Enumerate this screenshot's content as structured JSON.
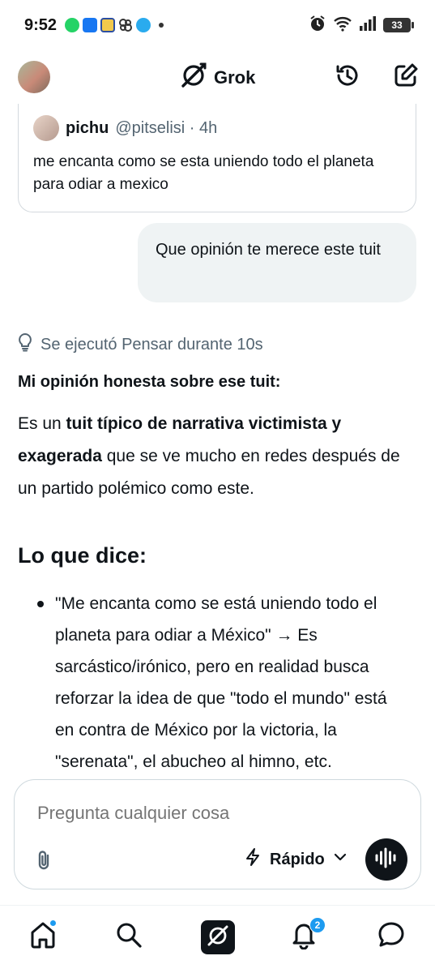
{
  "status_bar": {
    "time": "9:52",
    "battery": "33",
    "app_icons": [
      "whatsapp-icon",
      "facebook-icon",
      "news-icon",
      "pinwheel-icon",
      "telegram-icon",
      "more-dot-icon"
    ],
    "system_icons": [
      "alarm-icon",
      "wifi-icon",
      "signal-icon",
      "battery-icon"
    ]
  },
  "header": {
    "title": "Grok",
    "history_icon": "history-icon",
    "new_chat_icon": "compose-icon"
  },
  "quoted_tweet": {
    "name": "pichu",
    "handle": "@pitselisi · 4h",
    "text": "me encanta como se esta uniendo todo el planeta para odiar a mexico"
  },
  "user_message": "Que opinión te merece este tuit",
  "thinking": {
    "label": "Se ejecutó Pensar durante 10s"
  },
  "response": {
    "heading": "Mi opinión honesta sobre ese tuit:",
    "para_prefix": "Es un ",
    "para_bold": "tuit típico de narrativa victimista y exagerada",
    "para_suffix": " que se ve mucho en redes después de un partido polémico como este.",
    "section_title": "Lo que dice:",
    "bullets": [
      "\"Me encanta como se está uniendo todo el planeta para odiar a México\" → Es sarcástico/irónico, pero en realidad busca reforzar la idea de que \"todo el mundo\" está en contra de México por la victoria, la \"serenata\", el abucheo al himno, etc."
    ]
  },
  "composer": {
    "placeholder": "Pregunta cualquier cosa",
    "mode_label": "Rápido"
  },
  "bottom_nav": {
    "items": [
      "home-icon",
      "search-icon",
      "grok-icon",
      "notifications-icon",
      "messages-icon"
    ],
    "notifications_count": "2"
  },
  "colors": {
    "accent": "#1d9bf0",
    "text": "#0f1419",
    "muted": "#536471",
    "bubble": "#eff3f4"
  }
}
